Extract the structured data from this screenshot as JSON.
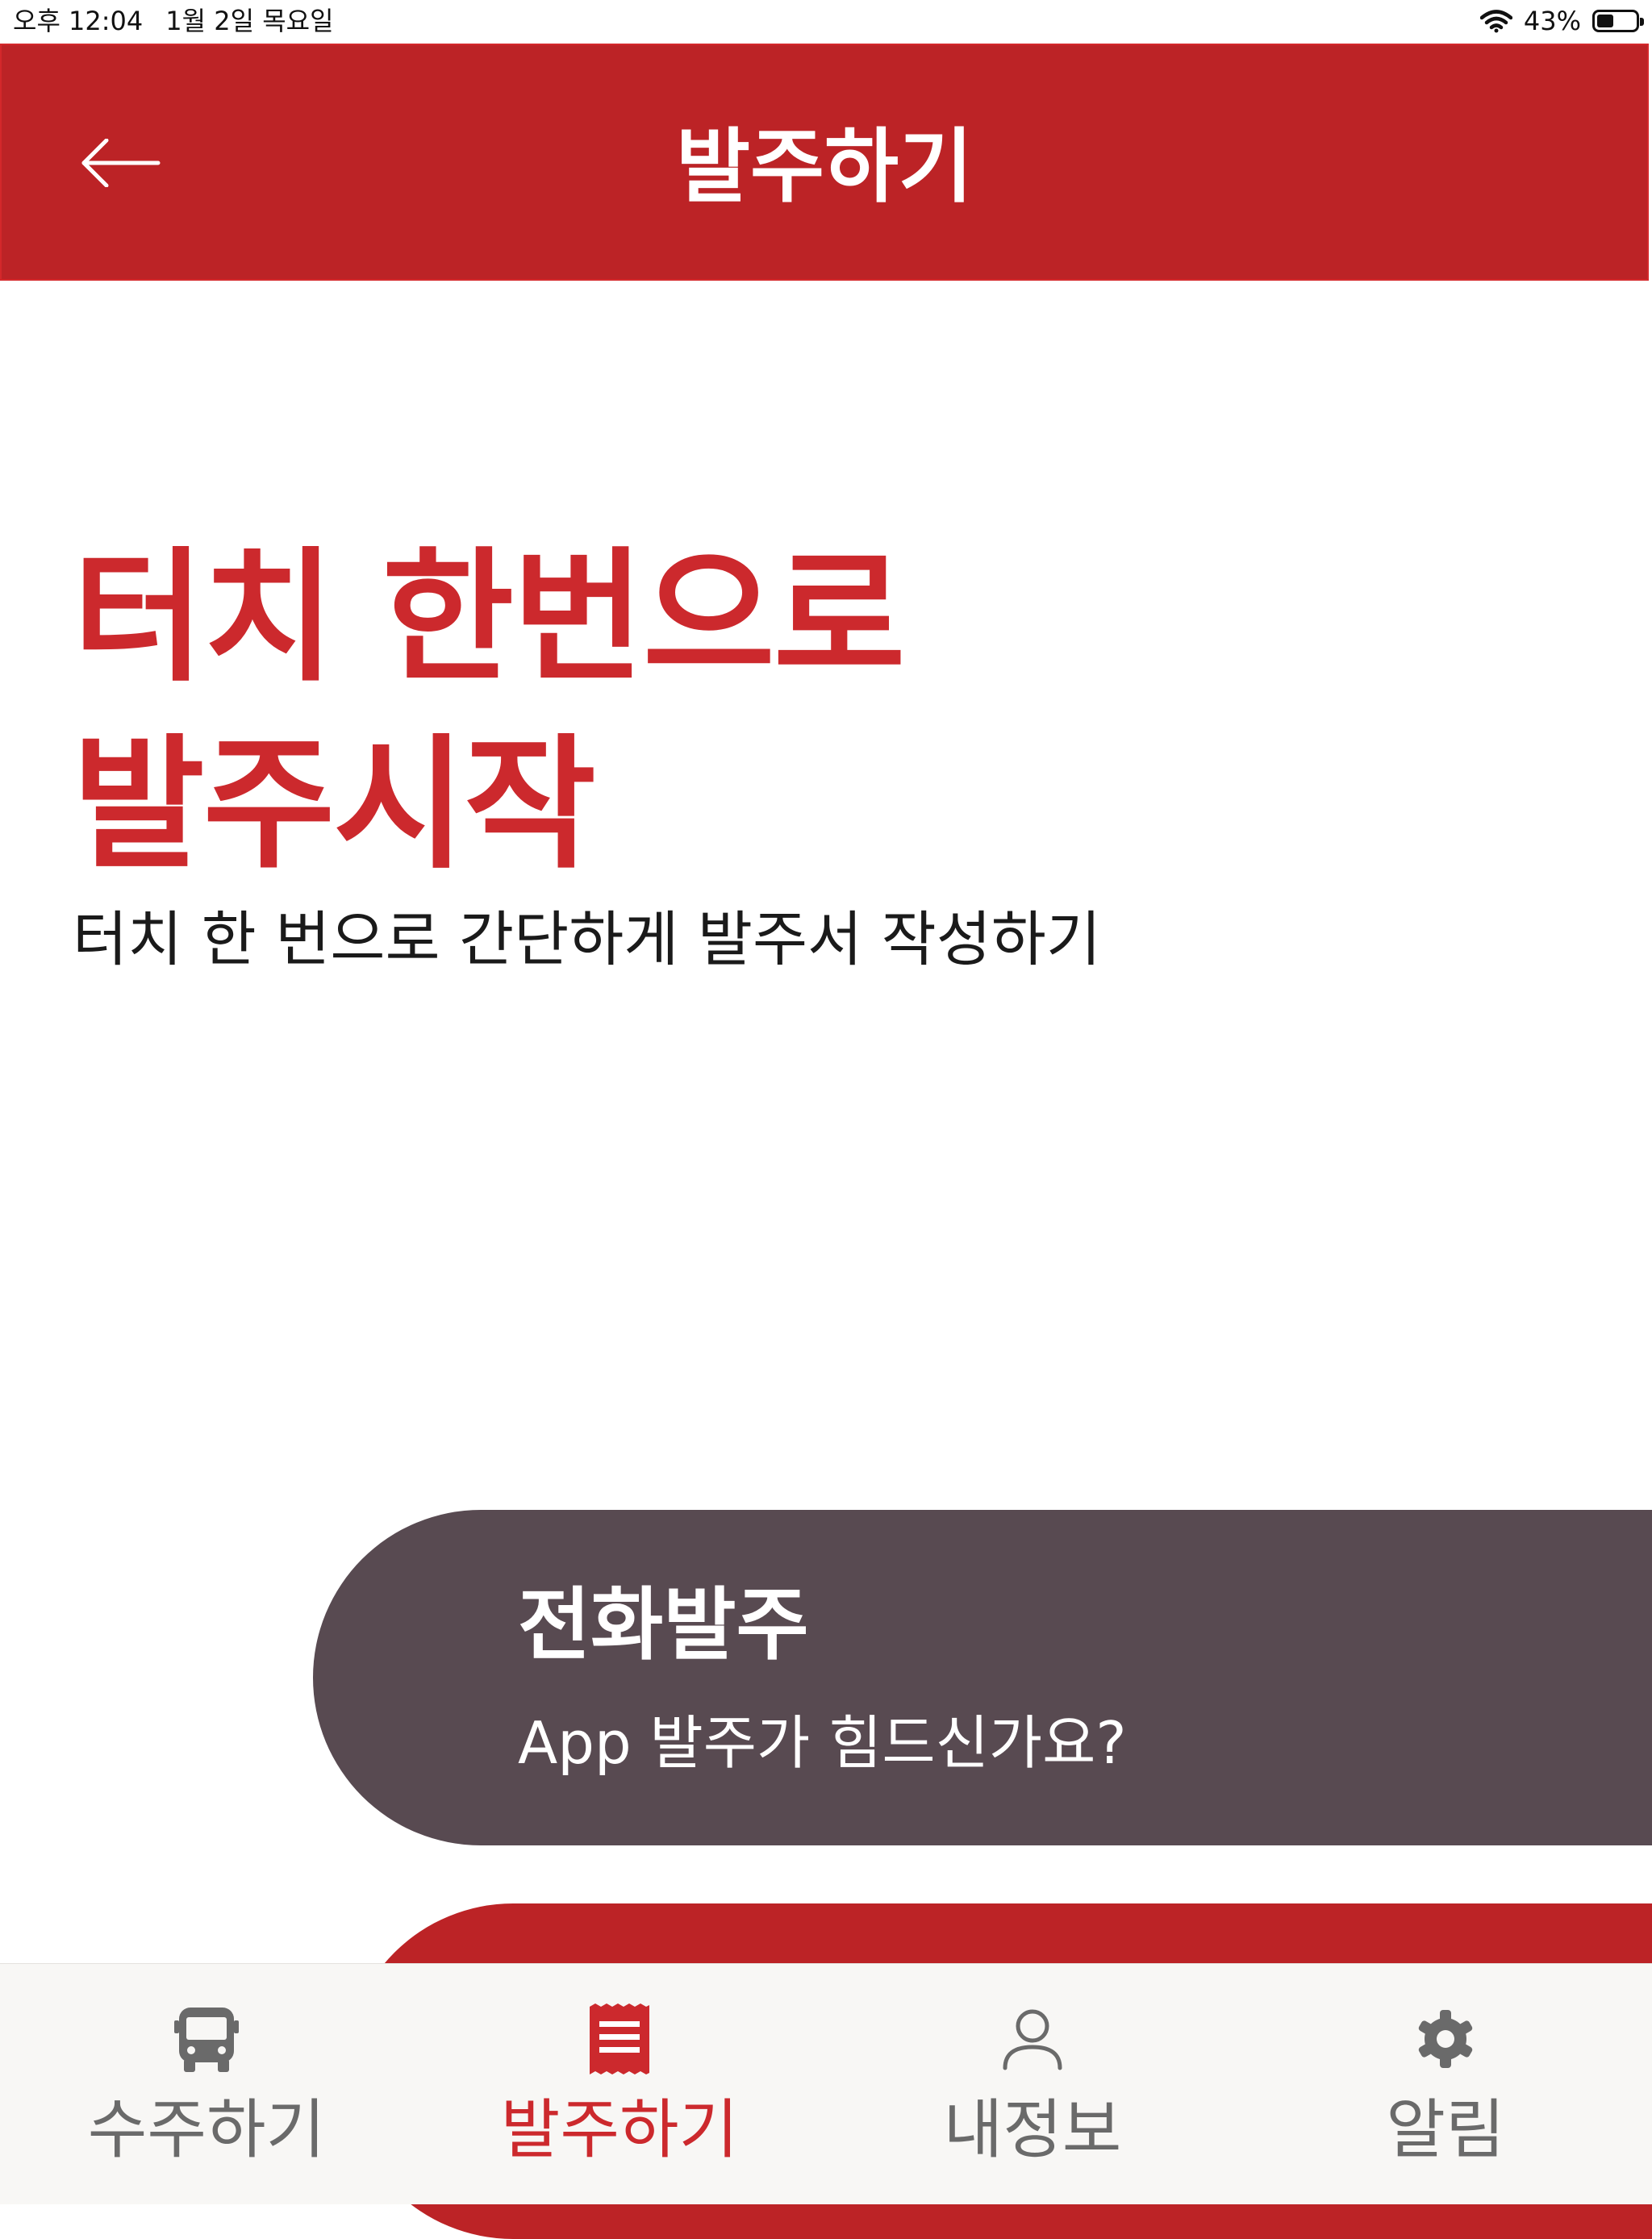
{
  "status_bar": {
    "time": "오후 12:04",
    "date": "1월 2일 목요일",
    "battery_percent": "43%",
    "battery_level": 0.43,
    "icons": [
      "wifi-icon",
      "battery-icon"
    ]
  },
  "header": {
    "title": "발주하기",
    "back_icon": "arrow-left-icon",
    "background_color": "#bc2326"
  },
  "hero": {
    "title_line1": "터치 한번으로",
    "title_line2": "발주시작",
    "subtitle": "터치 한 번으로 간단하게 발주서 작성하기",
    "accent_color": "#cc292d"
  },
  "phone_order_card": {
    "title": "전화발주",
    "subtitle": "App 발주가 힘드신가요?",
    "background_color": "#584a51"
  },
  "tab_bar": {
    "active_tab": "발주하기",
    "tabs": [
      {
        "label": "수주하기",
        "icon": "bus-icon"
      },
      {
        "label": "발주하기",
        "icon": "receipt-icon"
      },
      {
        "label": "내정보",
        "icon": "person-icon"
      },
      {
        "label": "알림",
        "icon": "gear-icon"
      }
    ]
  }
}
